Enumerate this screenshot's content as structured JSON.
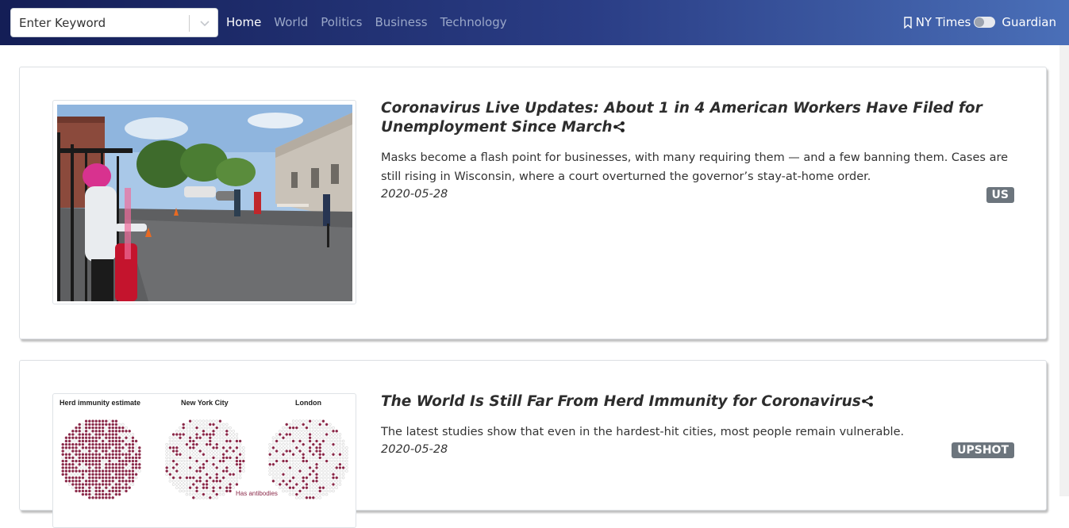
{
  "navbar": {
    "search_placeholder": "Enter Keyword",
    "links": [
      "Home",
      "World",
      "Politics",
      "Business",
      "Technology"
    ],
    "active_link": "Home",
    "source_left": "NY Times",
    "source_right": "Guardian"
  },
  "articles": [
    {
      "title": "Coronavirus Live Updates: About 1 in 4 American Workers Have Filed for Unemployment Since March",
      "summary": "Masks become a flash point for businesses, with many requiring them — and a few banning them. Cases are still rising in Wisconsin, where a court overturned the governor’s stay-at-home order.",
      "date": "2020-05-28",
      "section": "US",
      "image_semantic": "people-in-line-parking-lot-photo"
    },
    {
      "title": "The World Is Still Far From Herd Immunity for Coronavirus",
      "summary": "The latest studies show that even in the hardest-hit cities, most people remain vulnerable.",
      "date": "2020-05-28",
      "section": "UPSHOT",
      "image_semantic": "herd-immunity-dot-chart",
      "image_labels": [
        "Herd immunity estimate",
        "New York City",
        "London",
        "Has antibodies"
      ]
    }
  ],
  "colors": {
    "navbar_start": "#141e56",
    "navbar_end": "#4a6fb8",
    "badge": "#6c757d",
    "dot_infected": "#8b2a4a"
  }
}
